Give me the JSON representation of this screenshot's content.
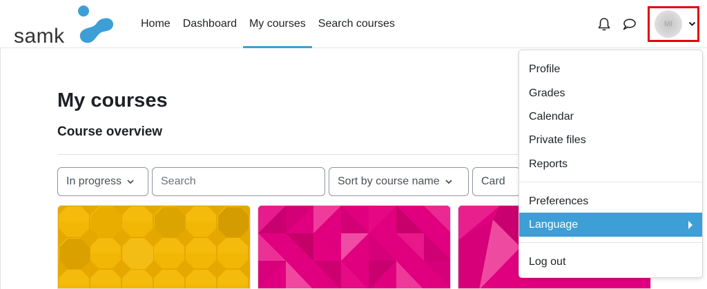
{
  "brand": {
    "logo_text": "samk",
    "accent": "#3d9fd5"
  },
  "nav": {
    "links": [
      {
        "label": "Home"
      },
      {
        "label": "Dashboard"
      },
      {
        "label": "My courses",
        "active": true
      },
      {
        "label": "Search courses"
      }
    ],
    "icons": [
      "bell-icon",
      "speech-bubble-icon"
    ],
    "user": {
      "initials": "MI",
      "highlight_color": "#e3000f"
    }
  },
  "main": {
    "title": "My courses",
    "section": "Course overview",
    "controls": {
      "filter": "In progress",
      "search_placeholder": "Search",
      "sort": "Sort by course name",
      "view": "Card"
    },
    "cards": [
      {
        "pattern": "octagon",
        "color": "#f0b400"
      },
      {
        "pattern": "triangles",
        "color": "#e0007f"
      },
      {
        "pattern": "triangles",
        "color": "#e0007f"
      }
    ]
  },
  "user_menu": {
    "items": [
      {
        "label": "Profile"
      },
      {
        "label": "Grades"
      },
      {
        "label": "Calendar"
      },
      {
        "label": "Private files"
      },
      {
        "label": "Reports"
      },
      {
        "label": "Preferences"
      },
      {
        "label": "Language",
        "active": true
      },
      {
        "label": "Log out"
      }
    ]
  }
}
